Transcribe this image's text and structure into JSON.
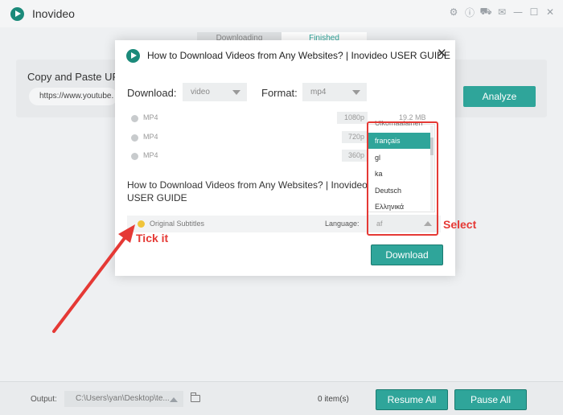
{
  "app": {
    "title": "Inovideo"
  },
  "window_icons": [
    "settings-icon",
    "info-icon",
    "cart-icon",
    "feedback-icon",
    "minimize-icon",
    "maximize-icon",
    "close-icon"
  ],
  "tabs": [
    {
      "label": "Downloading"
    },
    {
      "label": "Finished"
    }
  ],
  "paste": {
    "label": "Copy and Paste UR",
    "url_value": "https://www.youtube.",
    "analyze_label": "Analyze"
  },
  "dialog": {
    "title": "How to Download Videos from Any Websites? | Inovideo USER GUIDE",
    "close_symbol": "✕",
    "download_label": "Download:",
    "download_value": "video",
    "format_label": "Format:",
    "format_value": "mp4",
    "options": [
      {
        "format": "MP4",
        "resolution": "1080p",
        "size": "19.2 MB"
      },
      {
        "format": "MP4",
        "resolution": "720p",
        "size": ""
      },
      {
        "format": "MP4",
        "resolution": "360p",
        "size": ""
      }
    ],
    "video_title": "How to Download Videos from Any Websites? | Inovideo USER GUIDE",
    "subtitles_label": "Original Subtitles",
    "language_label": "Language:",
    "language_value": "af",
    "download_button": "Download"
  },
  "language_dropdown": {
    "partial_top": "Ulkomaalainen",
    "items": [
      "français",
      "gl",
      "ka",
      "Deutsch",
      "Ελληνικά"
    ],
    "selected": "français"
  },
  "annotations": {
    "select": "Select",
    "tick": "Tick it"
  },
  "bottom": {
    "output_label": "Output:",
    "output_path": "C:\\Users\\yan\\Desktop\\te...",
    "items_count": "0 item(s)",
    "resume_label": "Resume All",
    "pause_label": "Pause All"
  },
  "colors": {
    "accent": "#2fa59a",
    "annotation": "#e53935",
    "subtitle_dot": "#f0c43a"
  }
}
